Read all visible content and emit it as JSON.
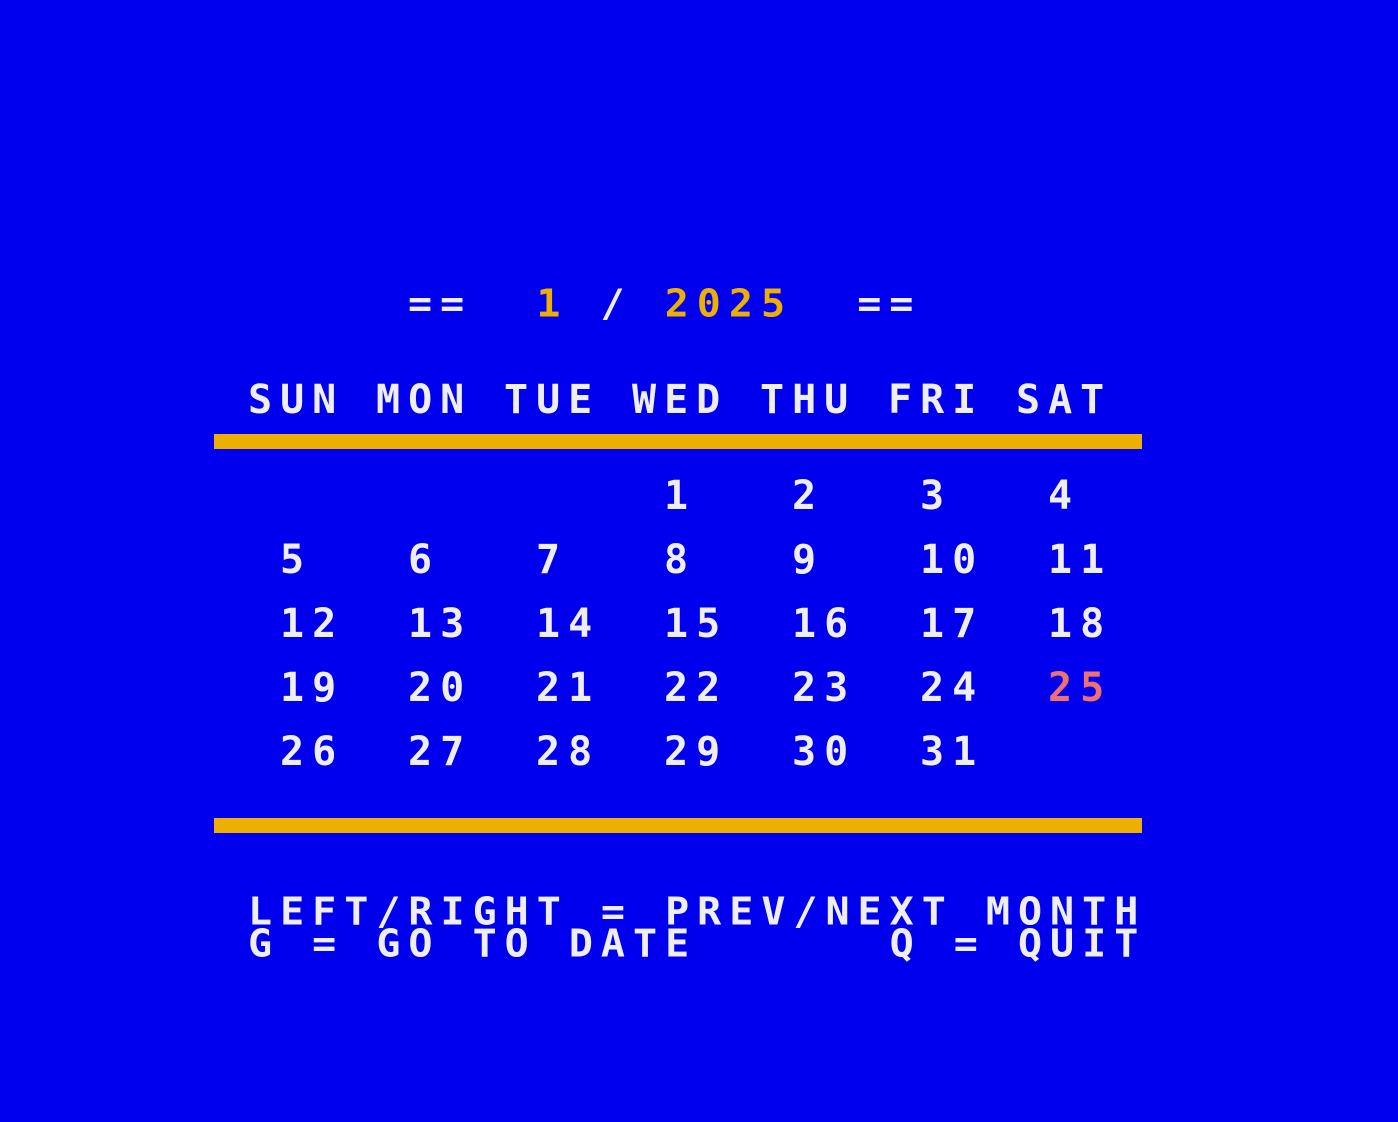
{
  "title": {
    "left_deco": "==",
    "month": "1",
    "separator": "/",
    "year": "2025",
    "right_deco": "=="
  },
  "weekdays": [
    "SUN",
    "MON",
    "TUE",
    "WED",
    "THU",
    "FRI",
    "SAT"
  ],
  "first_weekday_index": 3,
  "days_in_month": 31,
  "highlighted_day": 25,
  "colors": {
    "background": "#0000ee",
    "accent": "#eeb000",
    "text": "#eeeeee",
    "highlight": "#f07070"
  },
  "help": {
    "line1": "LEFT/RIGHT = PREV/NEXT MONTH",
    "line2": "G = GO TO DATE      Q = QUIT"
  }
}
